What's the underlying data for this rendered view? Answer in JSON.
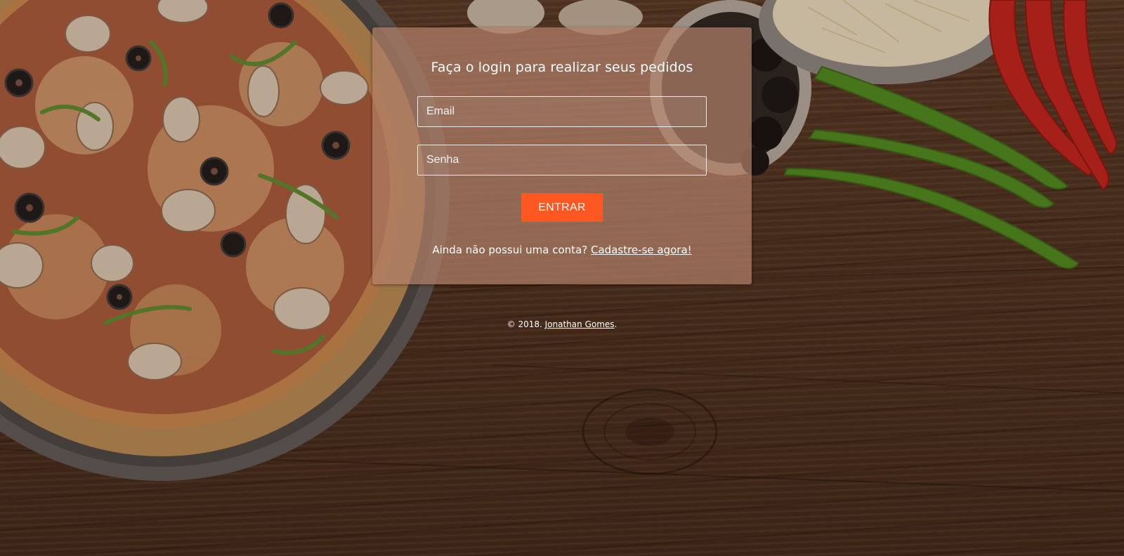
{
  "login": {
    "title": "Faça o login para realizar seus pedidos",
    "email_placeholder": "Email",
    "password_placeholder": "Senha",
    "submit_label": "ENTRAR",
    "signup_prompt": "Ainda não possui uma conta?",
    "signup_link": "Cadastre-se agora!"
  },
  "footer": {
    "copyright": "© 2018.",
    "author_link": "Jonathan Gomes",
    "suffix": "."
  },
  "colors": {
    "accent": "#ff5722",
    "card": "#b28068",
    "wood": "#4d3120"
  }
}
